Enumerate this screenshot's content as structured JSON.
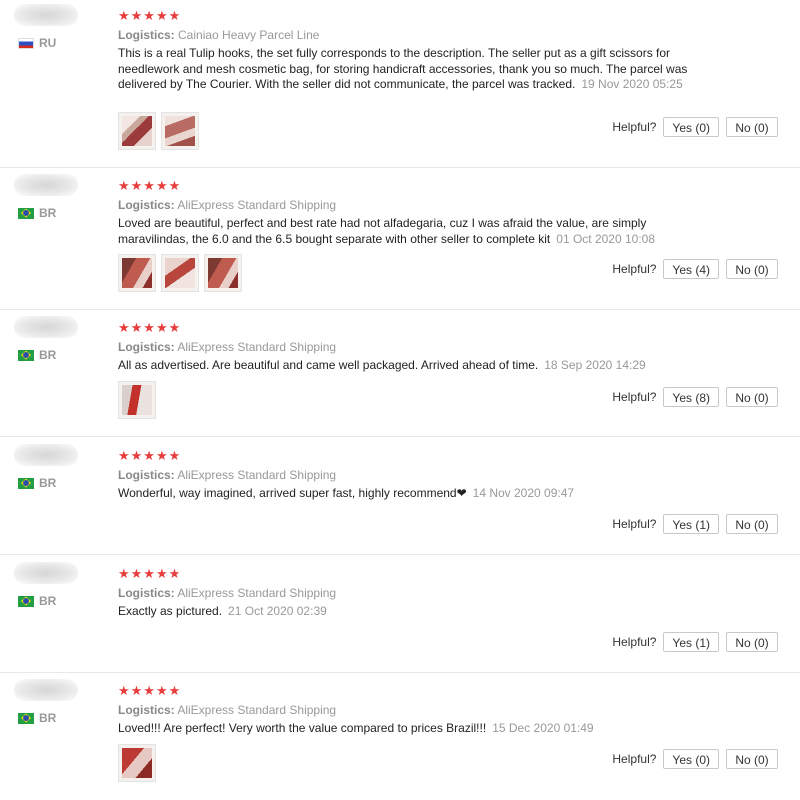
{
  "labels": {
    "logistics": "Logistics:",
    "helpful": "Helpful?",
    "stars": "★★★★★"
  },
  "reviews": [
    {
      "country": "RU",
      "flag": "ru-flag-icon",
      "rating": 5,
      "logistics": "Cainiao Heavy Parcel Line",
      "text": "This is a real Tulip hooks, the set fully corresponds to the description. The seller put as a gift scissors for needlework and mesh cosmetic bag, for storing handicraft accessories, thank you so much. The parcel was delivered by The Courier. With the seller did not communicate, the parcel was tracked.",
      "date": "19 Nov 2020 05:25",
      "photos": 2,
      "yes": "Yes (0)",
      "no": "No (0)"
    },
    {
      "country": "BR",
      "flag": "br-flag-icon",
      "rating": 5,
      "logistics": "AliExpress Standard Shipping",
      "text": "Loved are beautiful, perfect and best rate had not alfadegaria, cuz I was afraid the value, are simply maravilindas, the 6.0 and the 6.5 bought separate with other seller to complete kit",
      "date": "01 Oct 2020 10:08",
      "photos": 3,
      "yes": "Yes (4)",
      "no": "No (0)"
    },
    {
      "country": "BR",
      "flag": "br-flag-icon",
      "rating": 5,
      "logistics": "AliExpress Standard Shipping",
      "text": "All as advertised. Are beautiful and came well packaged. Arrived ahead of time.",
      "date": "18 Sep 2020 14:29",
      "photos": 1,
      "yes": "Yes (8)",
      "no": "No (0)"
    },
    {
      "country": "BR",
      "flag": "br-flag-icon",
      "rating": 5,
      "logistics": "AliExpress Standard Shipping",
      "text": "Wonderful, way imagined, arrived super fast, highly recommend❤",
      "date": "14 Nov 2020 09:47",
      "photos": 0,
      "yes": "Yes (1)",
      "no": "No (0)"
    },
    {
      "country": "BR",
      "flag": "br-flag-icon",
      "rating": 5,
      "logistics": "AliExpress Standard Shipping",
      "text": "Exactly as pictured.",
      "date": "21 Oct 2020 02:39",
      "photos": 0,
      "yes": "Yes (1)",
      "no": "No (0)"
    },
    {
      "country": "BR",
      "flag": "br-flag-icon",
      "rating": 5,
      "logistics": "AliExpress Standard Shipping",
      "text": "Loved!!! Are perfect! Very worth the value compared to prices Brazil!!!",
      "date": "15 Dec 2020 01:49",
      "photos": 1,
      "yes": "Yes (0)",
      "no": "No (0)"
    }
  ]
}
